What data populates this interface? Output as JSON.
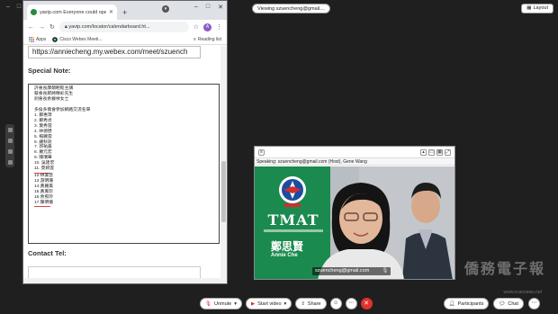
{
  "meeting": {
    "viewing_label": "Viewing szuencheng@gmail....",
    "layout_label": "Layout"
  },
  "browser": {
    "tab_title": "yavip.com Everyone could ope",
    "url": "yavip.com/locator/calendarboard.ht...",
    "avatar_letter": "A",
    "bookmarks": [
      {
        "label": "Apps"
      },
      {
        "label": "Cisco Webex Meeti..."
      },
      {
        "label": "Reading list"
      }
    ]
  },
  "page": {
    "meeting_link": "https://anniecheng.my.webex.com/meet/szuench",
    "special_note_label": "Special Note:",
    "contact_tel_label": "Contact Tel:",
    "note_lines_top": [
      "許會長康碩輕鬆主講",
      "蔡會長即將精彩先生",
      "劍會長余群林女士"
    ],
    "note_lines_mid": [
      "多倫多僑會參加網路交流名單"
    ],
    "attendees_1": [
      "1. 鄭惠萍",
      "2. 鄭秀貞",
      "3. 葉秀雲",
      "4. 林德懋",
      "5. 楊麗雲",
      "6. 鍾秋玫",
      "7. 郭祐嘉",
      "8. 羅元宏",
      "9. 陳瑞華",
      "10. 吳建宏",
      "11. 莫婉雲"
    ],
    "attendees_2": [
      "12.林美芸",
      "13.游明珊",
      "14.黃麗美",
      "15.黃鳳珍",
      "16.余照玲",
      "17.陳明儀"
    ]
  },
  "video": {
    "speaking_label": "Speaking: szuencheng@gmail.com (Host), Gene Wang",
    "banner_org": "TMAT",
    "banner_cn_name": "鄭思賢",
    "banner_en_name": "Annie Che",
    "participant_name": "szuencheng@gmail.com"
  },
  "toolbar": {
    "unmute_label": "Unmute",
    "start_video_label": "Start video",
    "share_label": "Share",
    "participants_label": "Participants",
    "chat_label": "Chat"
  },
  "watermark": {
    "text": "僑務電子報",
    "url": "www.ocacnews.net"
  },
  "colors": {
    "end_call": "#e0322e",
    "banner_green": "#1b8a4e",
    "dark_bg": "#1f1f1f"
  }
}
